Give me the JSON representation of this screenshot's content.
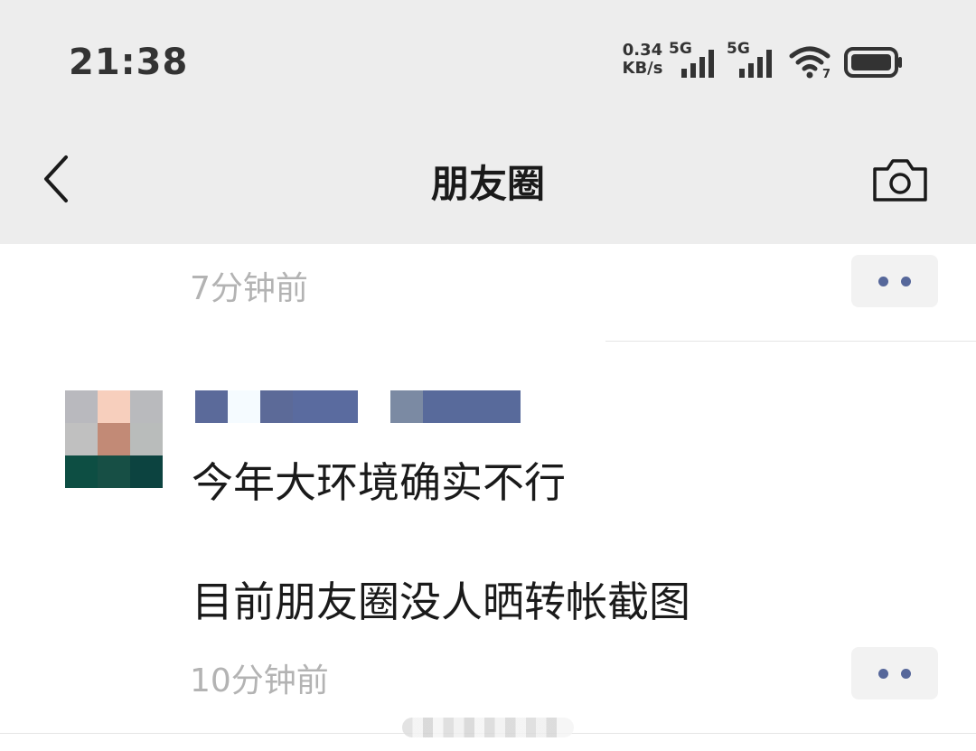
{
  "status_bar": {
    "time": "21:38",
    "net_speed_value": "0.34",
    "net_speed_unit": "KB/s",
    "sim1_label": "5G",
    "sim2_label": "5G",
    "wifi_badge": "7",
    "icons": [
      "signal-icon",
      "signal-icon",
      "wifi-icon",
      "battery-icon"
    ]
  },
  "nav": {
    "title": "朋友圈",
    "back_icon": "chevron-left-icon",
    "camera_icon": "camera-icon"
  },
  "feed": {
    "previous_post": {
      "time": "7分钟前"
    },
    "post": {
      "text_line1": "今年大环境确实不行",
      "text_line2": "目前朋友圈没人晒转帐截图",
      "time": "10分钟前"
    }
  },
  "colors": {
    "accent": "#56679a",
    "topbar_bg": "#ededed",
    "time_gray": "#b3b3b3"
  }
}
